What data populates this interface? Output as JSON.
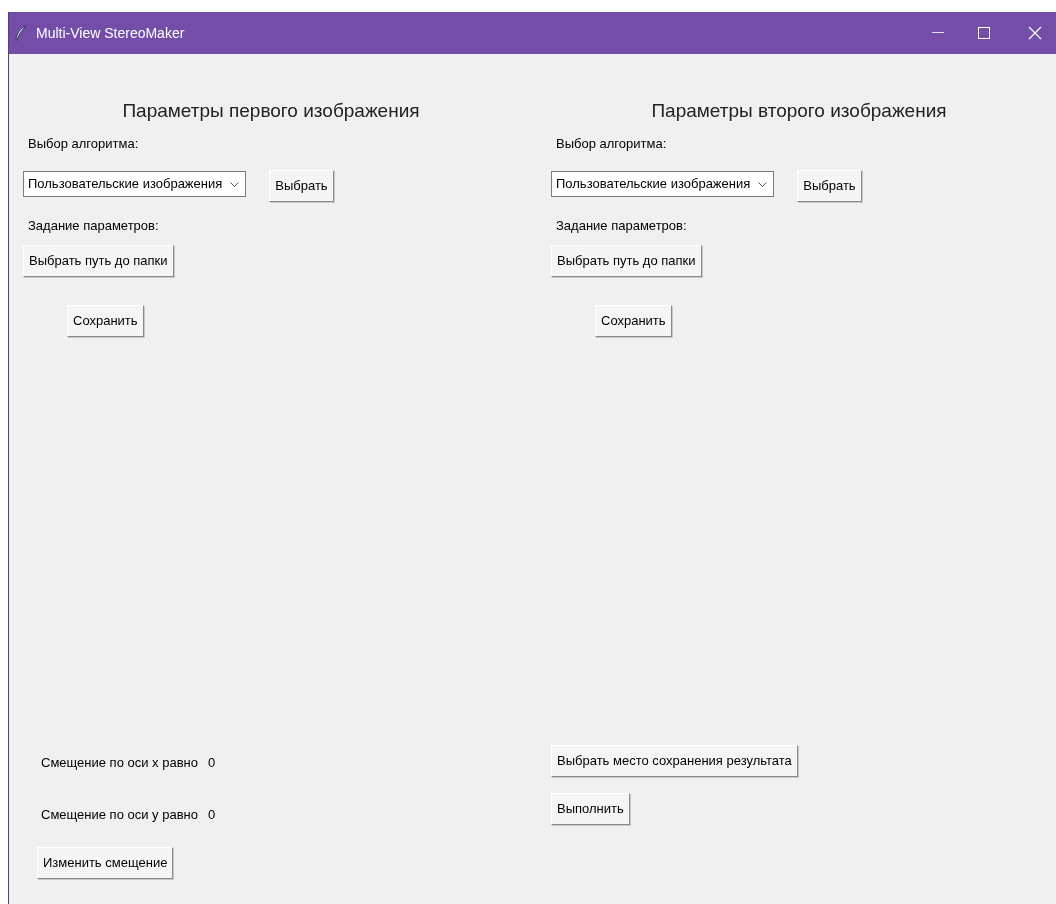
{
  "window": {
    "title": "Multi-View StereoMaker"
  },
  "panels": [
    {
      "heading": "Параметры первого изображения",
      "algorithm_label": "Выбор алгоритма:",
      "algorithm_value": "Пользовательские изображения",
      "select_button": "Выбрать",
      "params_label": "Задание параметров:",
      "folder_button": "Выбрать путь до папки",
      "save_button": "Сохранить"
    },
    {
      "heading": "Параметры второго изображения",
      "algorithm_label": "Выбор алгоритма:",
      "algorithm_value": "Пользовательские изображения",
      "select_button": "Выбрать",
      "params_label": "Задание параметров:",
      "folder_button": "Выбрать путь до папки",
      "save_button": "Сохранить"
    }
  ],
  "offsets": [
    {
      "label": "Смещение по оси x равно",
      "value": "0"
    },
    {
      "label": "Смещение по оси y равно",
      "value": "0"
    }
  ],
  "change_offset_button": "Изменить смещение",
  "result_path_button": "Выбрать место сохранения результата",
  "run_button": "Выполнить"
}
